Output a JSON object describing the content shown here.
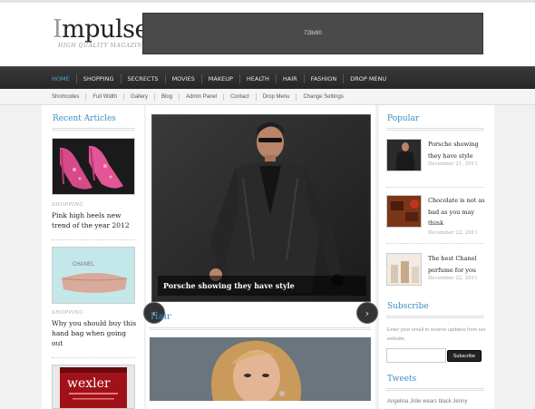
{
  "header": {
    "logo_cap": "I",
    "logo_rest": "mpulse",
    "tagline": "HIGH QUALITY MAGAZINE",
    "banner": "728x90"
  },
  "main_nav": [
    "HOME",
    "SHOPPING",
    "SECRECTS",
    "MOVIES",
    "MAKEUP",
    "HEALTH",
    "HAIR",
    "FASHION",
    "DROP MENU"
  ],
  "sub_nav": [
    "Shortcodes",
    "Full Width",
    "Gallery",
    "Blog",
    "Admin Panel",
    "Contact",
    "Drop Menu",
    "Change Settings"
  ],
  "recent": {
    "title": "Recent Articles",
    "articles": [
      {
        "category": "SHOPPING",
        "title": "Pink high heels new trend of the year 2012"
      },
      {
        "category": "SHOPPING",
        "title": "Why you should buy this hand bag when going out"
      }
    ],
    "bag_label": "CHANEL",
    "can_label": "wexler"
  },
  "slider": {
    "caption": "Porsche showing they have style",
    "prev": "‹",
    "next": "›"
  },
  "hair": {
    "title": "Hair"
  },
  "popular": {
    "title": "Popular",
    "items": [
      {
        "title": "Porsche showing they have style",
        "date": "December 21, 2011"
      },
      {
        "title": "Chocolate is not as bad as you may think",
        "date": "December 22, 2011"
      },
      {
        "title": "The best Chanel perfume for you",
        "date": "December 22, 2011"
      }
    ]
  },
  "subscribe": {
    "title": "Subscribe",
    "text": "Enter your email to recieve updates from our website.",
    "placeholder": "",
    "button": "Subscribe"
  },
  "tweets": {
    "title": "Tweets",
    "text": "Angelina Jolie wears black Jenny"
  },
  "colors": {
    "accent": "#3c8dc5",
    "nav_bg": "#2e2e2e",
    "active_nav": "#4fa3d6"
  }
}
